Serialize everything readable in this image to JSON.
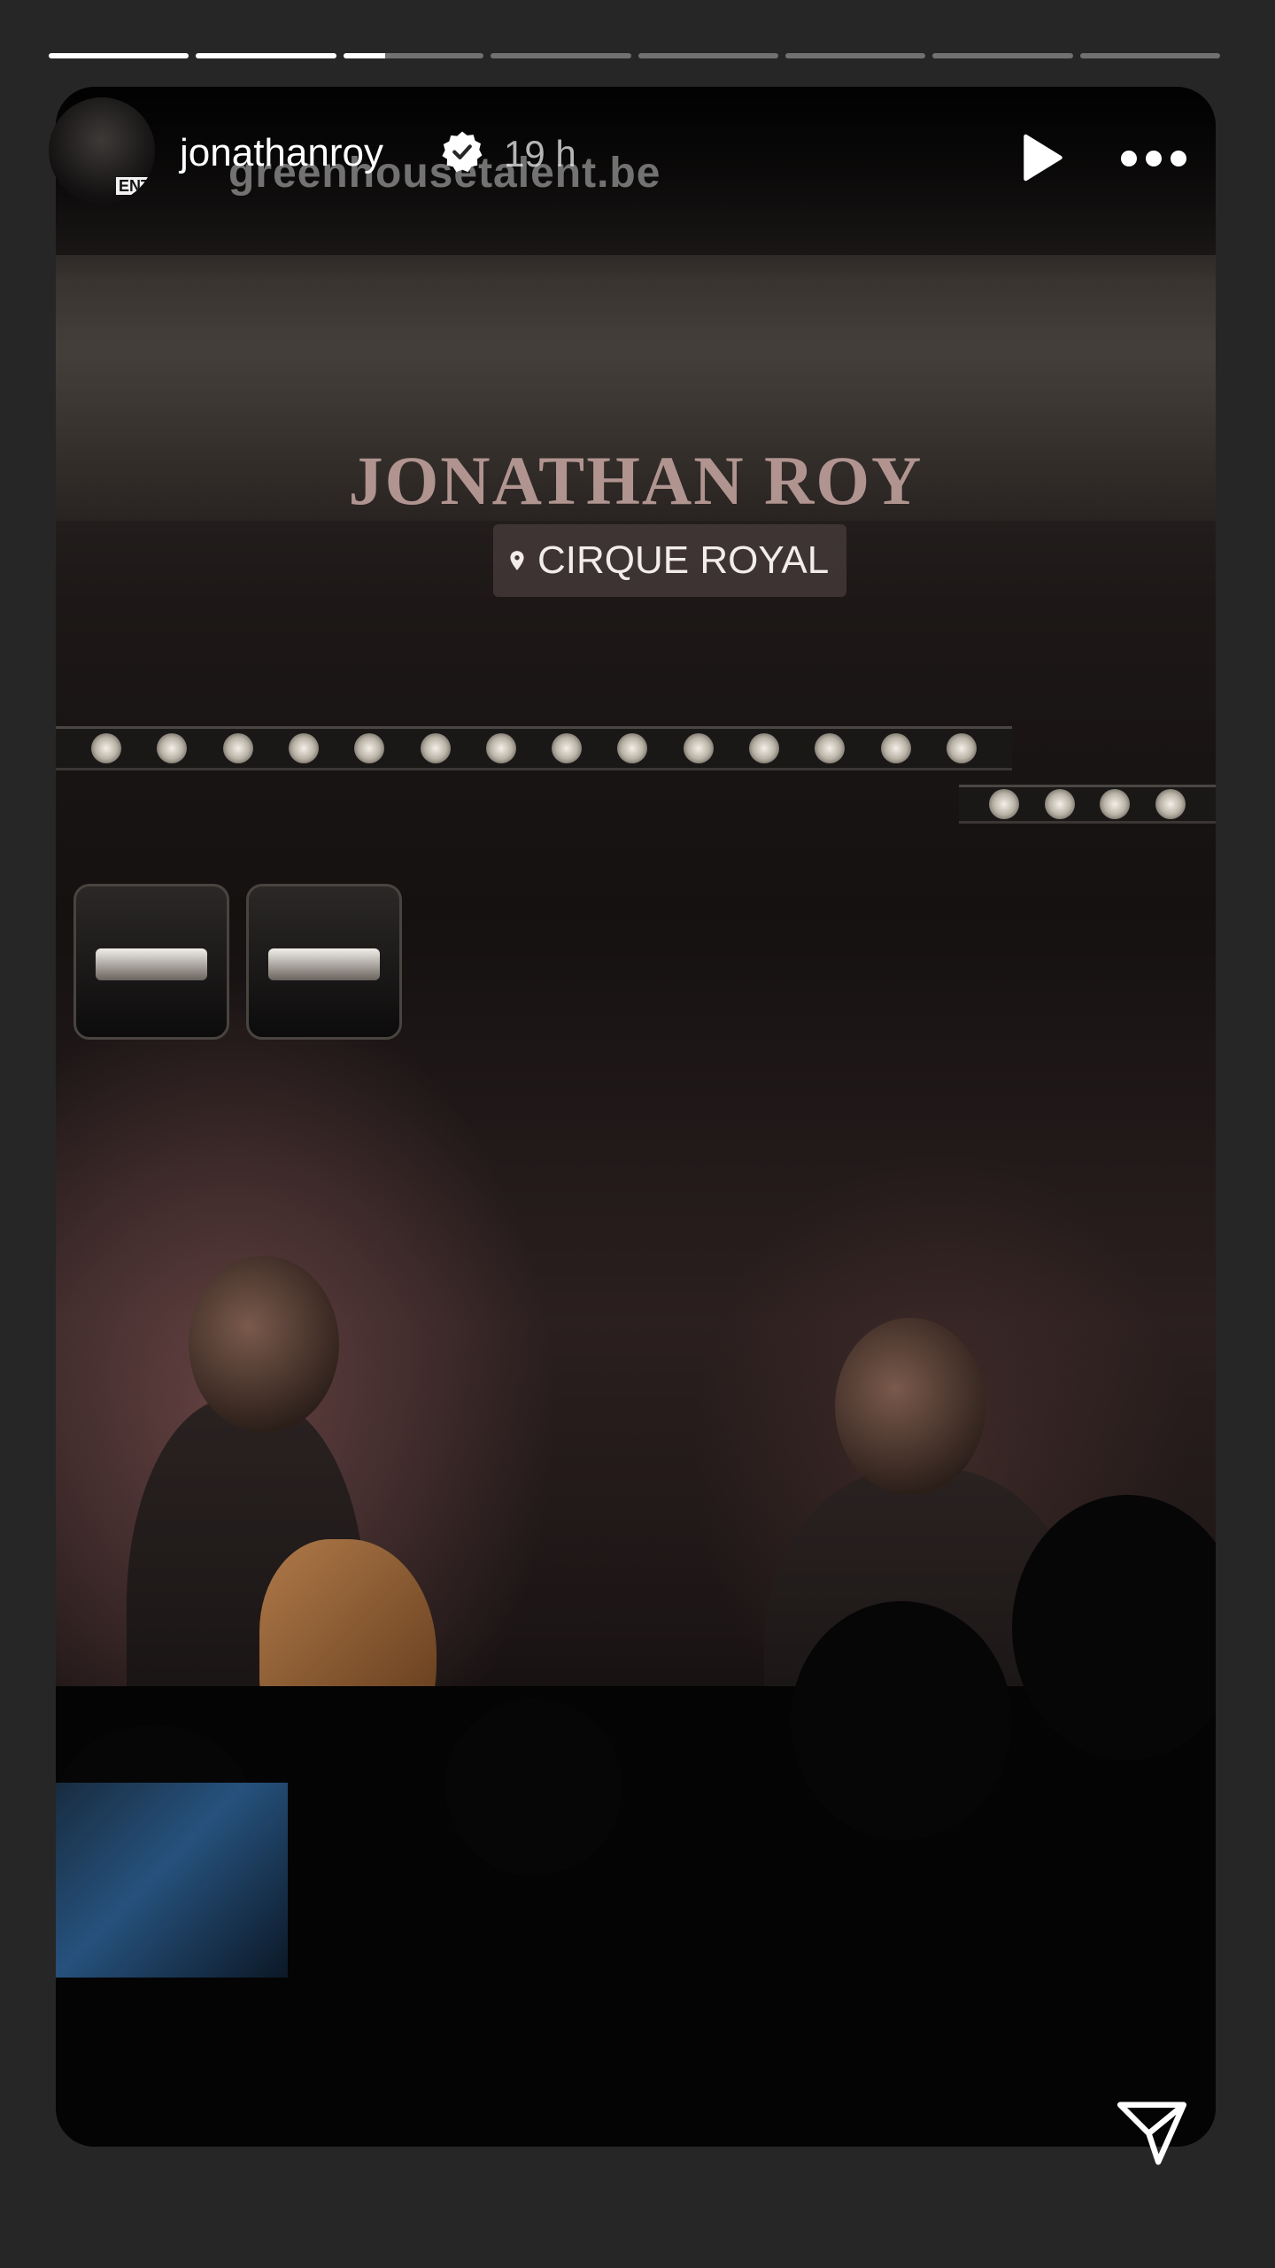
{
  "story": {
    "progress_segments": [
      1.0,
      1.0,
      0.3,
      0.0,
      0.0,
      0.0,
      0.0,
      0.0
    ],
    "overlay_title": "JONATHAN ROY",
    "location_sticker": "CIRQUE ROYAL",
    "watermark": "greenhousetalent.be"
  },
  "header": {
    "username": "jonathanroy",
    "verified": true,
    "time_ago": "19 h",
    "avatar_tag": "ENT"
  },
  "icons": {
    "verified": "verified-badge-icon",
    "play": "play-icon",
    "more": "more-options-icon",
    "send": "send-icon",
    "location": "location-pin-icon"
  },
  "colors": {
    "background": "#262626",
    "title_tint": "#b89a96",
    "sticker_bg": "#443838"
  }
}
